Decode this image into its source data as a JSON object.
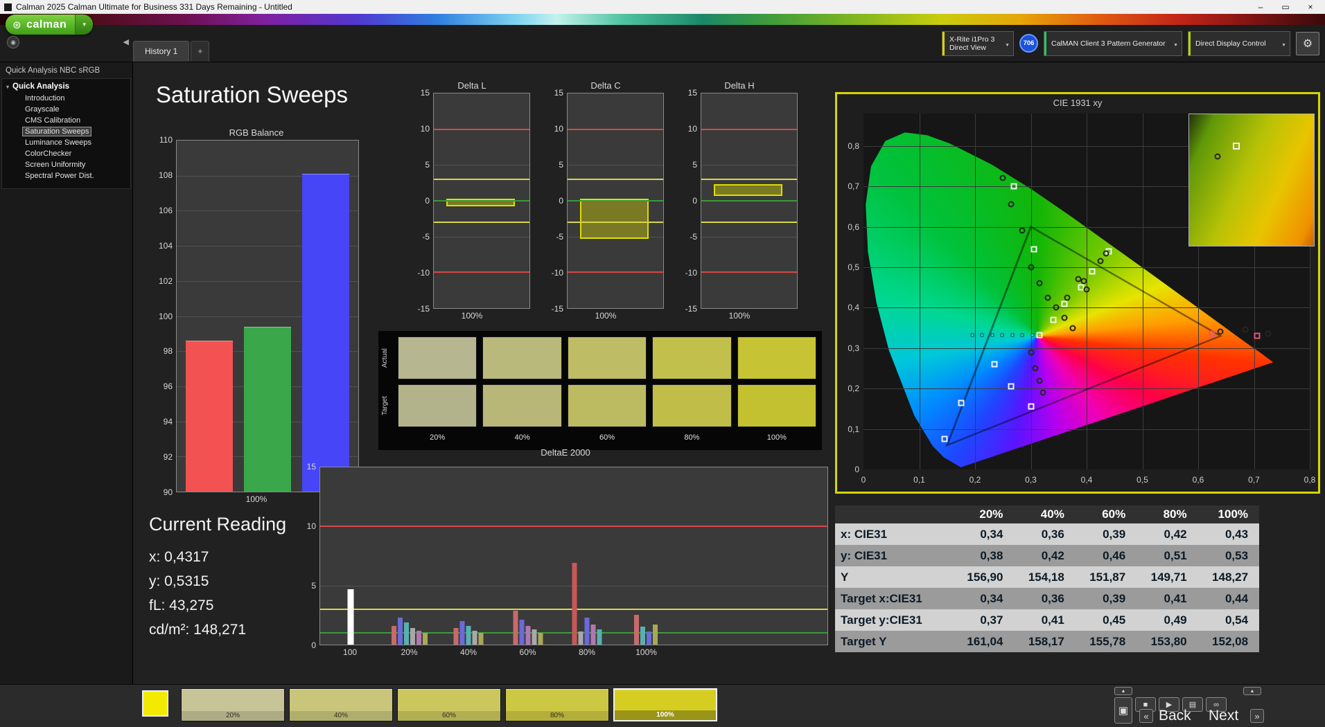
{
  "window": {
    "title": "Calman 2025 Calman Ultimate for Business 331 Days Remaining  - Untitled",
    "minimize": "–",
    "maximize": "▭",
    "close": "×"
  },
  "logo": {
    "text": "calman",
    "icon": "⊛",
    "dropdown": "▼"
  },
  "topbar": {
    "aperture_icon": "◉",
    "collapse_icon": "◀",
    "tab_label": "History 1",
    "tab_add": "+",
    "meter_line1": "X-Rite i1Pro 3",
    "meter_line2": "Direct View",
    "badge": "706",
    "pattern_generator": "CalMAN Client 3 Pattern Generator",
    "display_control": "Direct Display Control",
    "gear_icon": "⚙",
    "dropdown_arrow": "▼",
    "meter_strip_color": "#d6d600",
    "pattern_strip_color": "#30c060",
    "display_strip_color": "#b8d600"
  },
  "sidebar": {
    "header": "Quick Analysis NBC sRGB",
    "root": "Quick Analysis",
    "items": [
      {
        "label": "Introduction",
        "selected": false
      },
      {
        "label": "Grayscale",
        "selected": false
      },
      {
        "label": "CMS Calibration",
        "selected": false
      },
      {
        "label": "Saturation Sweeps",
        "selected": true
      },
      {
        "label": "Luminance Sweeps",
        "selected": false
      },
      {
        "label": "ColorChecker",
        "selected": false
      },
      {
        "label": "Screen Uniformity",
        "selected": false
      },
      {
        "label": "Spectral Power Dist.",
        "selected": false
      }
    ]
  },
  "page": {
    "title": "Saturation Sweeps"
  },
  "current_reading": {
    "title": "Current Reading",
    "x": "x: 0,4317",
    "y": "y: 0,5315",
    "fl": "fL: 43,275",
    "cdm2": "cd/m²: 148,271"
  },
  "swatch_panel": {
    "row_labels": [
      "Actual",
      "Target"
    ],
    "col_labels": [
      "20%",
      "40%",
      "60%",
      "80%",
      "100%"
    ],
    "actual_colors": [
      "#b6b690",
      "#bab97c",
      "#bebd66",
      "#c2c04c",
      "#c6c334"
    ],
    "target_colors": [
      "#b3b38b",
      "#b8b778",
      "#bcbb62",
      "#c0be48",
      "#c4c130"
    ]
  },
  "chart_data": [
    {
      "id": "rgb_balance",
      "type": "bar",
      "title": "RGB Balance",
      "categories": [
        "Red",
        "Green",
        "Blue"
      ],
      "values": [
        98.6,
        99.4,
        108.1
      ],
      "colors": [
        "#f25252",
        "#3aa84a",
        "#4646f8"
      ],
      "ylim": [
        90,
        110
      ],
      "ytick_step": 2,
      "xlabel": "100%"
    },
    {
      "id": "delta_l",
      "type": "bar",
      "title": "Delta L",
      "ylim": [
        -15,
        15
      ],
      "ytick_step": 5,
      "xlabel": "100%",
      "value": -0.4,
      "bar_range": [
        -0.8,
        0.3
      ],
      "ref_lines": [
        {
          "y": 10,
          "color": "#d84848"
        },
        {
          "y": -10,
          "color": "#d84848"
        },
        {
          "y": 3,
          "color": "#d8d848"
        },
        {
          "y": -3,
          "color": "#d8d848"
        },
        {
          "y": 0,
          "color": "#3a9a3a"
        }
      ]
    },
    {
      "id": "delta_c",
      "type": "bar",
      "title": "Delta C",
      "ylim": [
        -15,
        15
      ],
      "ytick_step": 5,
      "xlabel": "100%",
      "value": -5.0,
      "bar_range": [
        -5.3,
        0.3
      ],
      "ref_lines": [
        {
          "y": 10,
          "color": "#d84848"
        },
        {
          "y": -10,
          "color": "#d84848"
        },
        {
          "y": 3,
          "color": "#d8d848"
        },
        {
          "y": -3,
          "color": "#d8d848"
        },
        {
          "y": 0,
          "color": "#3a9a3a"
        }
      ]
    },
    {
      "id": "delta_h",
      "type": "bar",
      "title": "Delta H",
      "ylim": [
        -15,
        15
      ],
      "ytick_step": 5,
      "xlabel": "100%",
      "value": 2.0,
      "bar_range": [
        0.7,
        2.3
      ],
      "ref_lines": [
        {
          "y": 10,
          "color": "#d84848"
        },
        {
          "y": -10,
          "color": "#d84848"
        },
        {
          "y": 3,
          "color": "#d8d848"
        },
        {
          "y": -3,
          "color": "#d8d848"
        },
        {
          "y": 0,
          "color": "#3a9a3a"
        }
      ]
    },
    {
      "id": "deltae2000",
      "type": "bar",
      "title": "DeltaE 2000",
      "ylim": [
        0,
        15
      ],
      "yticks": [
        0,
        5,
        10,
        15
      ],
      "ref_lines": [
        {
          "y": 10,
          "color": "#d84848"
        },
        {
          "y": 3,
          "color": "#d8d848"
        },
        {
          "y": 1,
          "color": "#3a9a3a"
        }
      ],
      "groups": [
        {
          "label": "100",
          "bars": [
            {
              "value": 4.7,
              "color": "#ffffff"
            }
          ]
        },
        {
          "label": "20%",
          "bars": [
            {
              "value": 1.6,
              "color": "#c86a6a"
            },
            {
              "value": 2.3,
              "color": "#6a6ad8"
            },
            {
              "value": 1.9,
              "color": "#58b0b0"
            },
            {
              "value": 1.4,
              "color": "#a8a8a8"
            },
            {
              "value": 1.2,
              "color": "#b078b0"
            },
            {
              "value": 1.0,
              "color": "#a8a858"
            }
          ]
        },
        {
          "label": "40%",
          "bars": [
            {
              "value": 1.4,
              "color": "#c86a6a"
            },
            {
              "value": 2.0,
              "color": "#6a6ad8"
            },
            {
              "value": 1.6,
              "color": "#58b0b0"
            },
            {
              "value": 1.2,
              "color": "#a8a8a8"
            },
            {
              "value": 1.0,
              "color": "#a8a858"
            }
          ]
        },
        {
          "label": "60%",
          "bars": [
            {
              "value": 2.9,
              "color": "#c86a6a"
            },
            {
              "value": 2.1,
              "color": "#6a6ad8"
            },
            {
              "value": 1.6,
              "color": "#b078b0"
            },
            {
              "value": 1.3,
              "color": "#a8a8a8"
            },
            {
              "value": 1.0,
              "color": "#a8a858"
            }
          ]
        },
        {
          "label": "80%",
          "bars": [
            {
              "value": 6.9,
              "color": "#c85858"
            },
            {
              "value": 1.1,
              "color": "#a8a8a8"
            },
            {
              "value": 2.3,
              "color": "#6a6ad8"
            },
            {
              "value": 1.7,
              "color": "#b078b0"
            },
            {
              "value": 1.3,
              "color": "#58b0b0"
            }
          ]
        },
        {
          "label": "100%",
          "bars": [
            {
              "value": 2.5,
              "color": "#c86a6a"
            },
            {
              "value": 1.5,
              "color": "#58b0b0"
            },
            {
              "value": 1.1,
              "color": "#6a6ad8"
            },
            {
              "value": 1.7,
              "color": "#a8a858"
            }
          ]
        }
      ]
    },
    {
      "id": "cie",
      "type": "scatter",
      "title": "CIE 1931 xy",
      "xlim": [
        0,
        0.8
      ],
      "ylim": [
        0,
        0.88
      ],
      "tick_step": 0.1,
      "tick_max": 0.8,
      "white_squares": [
        [
          0.27,
          0.7
        ],
        [
          0.305,
          0.545
        ],
        [
          0.34,
          0.37
        ],
        [
          0.36,
          0.41
        ],
        [
          0.39,
          0.45
        ],
        [
          0.41,
          0.49
        ],
        [
          0.44,
          0.54
        ],
        [
          0.315,
          0.332
        ],
        [
          0.235,
          0.26
        ],
        [
          0.265,
          0.205
        ],
        [
          0.3,
          0.155
        ],
        [
          0.175,
          0.165
        ],
        [
          0.145,
          0.075
        ]
      ],
      "red_squares": [
        [
          0.625,
          0.335
        ],
        [
          0.705,
          0.33
        ]
      ],
      "circles": [
        [
          0.25,
          0.72
        ],
        [
          0.265,
          0.655
        ],
        [
          0.285,
          0.59
        ],
        [
          0.3,
          0.5
        ],
        [
          0.315,
          0.46
        ],
        [
          0.33,
          0.425
        ],
        [
          0.345,
          0.4
        ],
        [
          0.36,
          0.375
        ],
        [
          0.375,
          0.35
        ],
        [
          0.385,
          0.47
        ],
        [
          0.4,
          0.445
        ],
        [
          0.365,
          0.425
        ],
        [
          0.395,
          0.465
        ],
        [
          0.425,
          0.515
        ],
        [
          0.435,
          0.535
        ],
        [
          0.64,
          0.34
        ],
        [
          0.685,
          0.345
        ],
        [
          0.725,
          0.335
        ],
        [
          0.3,
          0.29
        ],
        [
          0.308,
          0.25
        ],
        [
          0.315,
          0.22
        ],
        [
          0.322,
          0.19
        ]
      ],
      "cyan_ticks": [
        [
          0.195,
          0.332
        ],
        [
          0.213,
          0.332
        ],
        [
          0.231,
          0.332
        ],
        [
          0.249,
          0.332
        ],
        [
          0.267,
          0.332
        ],
        [
          0.285,
          0.332
        ],
        [
          0.303,
          0.332
        ]
      ],
      "triangle": [
        [
          0.64,
          0.33
        ],
        [
          0.3,
          0.6
        ],
        [
          0.15,
          0.06
        ]
      ]
    }
  ],
  "table": {
    "columns": [
      "",
      "20%",
      "40%",
      "60%",
      "80%",
      "100%"
    ],
    "rows": [
      {
        "label": "x: CIE31",
        "values": [
          "0,34",
          "0,36",
          "0,39",
          "0,42",
          "0,43"
        ]
      },
      {
        "label": "y: CIE31",
        "values": [
          "0,38",
          "0,42",
          "0,46",
          "0,51",
          "0,53"
        ]
      },
      {
        "label": "Y",
        "values": [
          "156,90",
          "154,18",
          "151,87",
          "149,71",
          "148,27"
        ]
      },
      {
        "label": "Target x:CIE31",
        "values": [
          "0,34",
          "0,36",
          "0,39",
          "0,41",
          "0,44"
        ]
      },
      {
        "label": "Target y:CIE31",
        "values": [
          "0,37",
          "0,41",
          "0,45",
          "0,49",
          "0,54"
        ]
      },
      {
        "label": "Target Y",
        "values": [
          "161,04",
          "158,17",
          "155,78",
          "153,80",
          "152,08"
        ]
      }
    ]
  },
  "bottom": {
    "current_color": "#f2ea00",
    "swatches": [
      {
        "label": "20%",
        "color": "#c7c497"
      },
      {
        "label": "40%",
        "color": "#c9c67c"
      },
      {
        "label": "60%",
        "color": "#cbc75e"
      },
      {
        "label": "80%",
        "color": "#cdc844"
      },
      {
        "label": "100%",
        "color": "#d6cd22"
      }
    ],
    "selected": "100%",
    "icons": {
      "up": "▲",
      "stop": "■",
      "play": "▶",
      "save": "▤",
      "loop": "∞",
      "screen": "▣",
      "prev": "«",
      "next_ch": "»"
    },
    "back": "Back",
    "next": "Next"
  }
}
